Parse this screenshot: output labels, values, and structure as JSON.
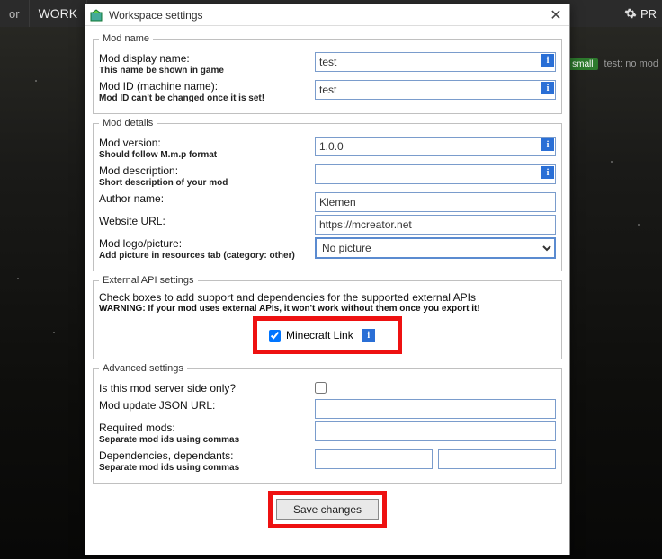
{
  "topbar": {
    "item1": "or",
    "item2": "WORK",
    "pr": "PR"
  },
  "tagrow": {
    "tag": "small",
    "text": "test: no mod"
  },
  "dialog": {
    "title": "Workspace settings",
    "mod_name": {
      "legend": "Mod name",
      "display_label": "Mod display name:",
      "display_sub": "This name be shown in game",
      "display_value": "test",
      "id_label": "Mod ID (machine name):",
      "id_sub": "Mod ID can't be changed once it is set!",
      "id_value": "test"
    },
    "mod_details": {
      "legend": "Mod details",
      "version_label": "Mod version:",
      "version_sub": "Should follow M.m.p format",
      "version_value": "1.0.0",
      "desc_label": "Mod description:",
      "desc_sub": "Short description of your mod",
      "desc_value": "",
      "author_label": "Author name:",
      "author_value": "Klemen",
      "url_label": "Website URL:",
      "url_value": "https://mcreator.net",
      "logo_label": "Mod logo/picture:",
      "logo_sub": "Add picture in resources tab (category: other)",
      "logo_value": "No picture"
    },
    "external": {
      "legend": "External API settings",
      "desc": "Check boxes to add support and dependencies for the supported external APIs",
      "warn": "WARNING: If your mod uses external APIs, it won't work without them once you export it!",
      "link_label": "Minecraft Link",
      "link_checked": true
    },
    "advanced": {
      "legend": "Advanced settings",
      "server_label": "Is this mod server side only?",
      "server_checked": false,
      "update_label": "Mod update JSON URL:",
      "update_value": "",
      "required_label": "Required mods:",
      "required_sub": "Separate mod ids using commas",
      "required_value": "",
      "deps_label": "Dependencies, dependants:",
      "deps_sub": "Separate mod ids using commas",
      "deps_a": "",
      "deps_b": ""
    },
    "save_label": "Save changes"
  }
}
